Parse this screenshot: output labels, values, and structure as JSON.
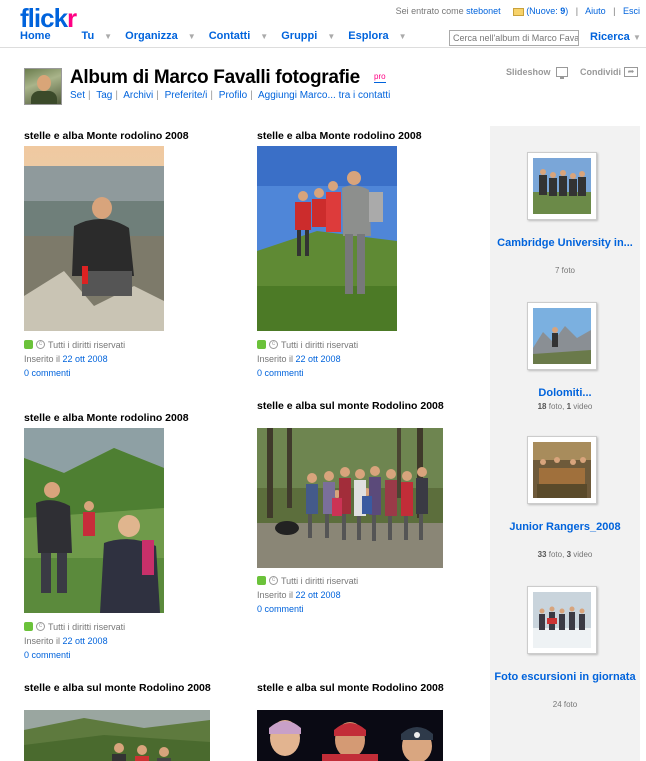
{
  "brand": {
    "logo_main": "flick",
    "logo_r": "r"
  },
  "account": {
    "signed_in_text": "Sei entrato come",
    "username": "stebonet",
    "mail_prefix": "(Nuove: ",
    "mail_count": "9",
    "mail_suffix": ")",
    "help": "Aiuto",
    "logout": "Esci"
  },
  "nav": {
    "home": "Home",
    "you": "Tu",
    "organize": "Organizza",
    "contacts": "Contatti",
    "groups": "Gruppi",
    "explore": "Esplora",
    "caret": "▼"
  },
  "search": {
    "placeholder": "Cerca nell'album di Marco Favalli",
    "button": "Ricerca"
  },
  "header": {
    "title": "Album di Marco Favalli fotografie",
    "pro": "pro",
    "links": [
      "Set",
      "Tag",
      "Archivi",
      "Preferite/i",
      "Profilo",
      "Aggiungi Marco... tra i contatti"
    ],
    "slideshow": "Slideshow",
    "share": "Condividi"
  },
  "photo_meta": {
    "rights": "Tutti i diritti riservati",
    "posted_prefix": "Inserito il"
  },
  "photos": [
    {
      "title": "stelle e alba Monte rodolino 2008",
      "date": "22 ott 2008",
      "comments": "0 commenti"
    },
    {
      "title": "stelle e alba Monte rodolino 2008",
      "date": "22 ott 2008",
      "comments": "0 commenti"
    },
    {
      "title": "stelle e alba Monte rodolino 2008",
      "date": "22 ott 2008",
      "comments": "0 commenti"
    },
    {
      "title": "stelle e alba sul monte Rodolino 2008",
      "date": "22 ott 2008",
      "comments": "0 commenti"
    },
    {
      "title": "stelle e alba sul monte Rodolino 2008"
    },
    {
      "title": "stelle e alba sul monte Rodolino 2008"
    }
  ],
  "sets": [
    {
      "title": "Cambridge University in...",
      "count_text": "7 foto"
    },
    {
      "title": "Dolomiti...",
      "photos": "18",
      "photos_label": "foto,",
      "videos": "1",
      "videos_label": "video"
    },
    {
      "title": "Junior Rangers_2008",
      "photos": "33",
      "photos_label": "foto,",
      "videos": "3",
      "videos_label": "video"
    },
    {
      "title": "Foto escursioni in giornata",
      "count_text": "24 foto"
    }
  ]
}
